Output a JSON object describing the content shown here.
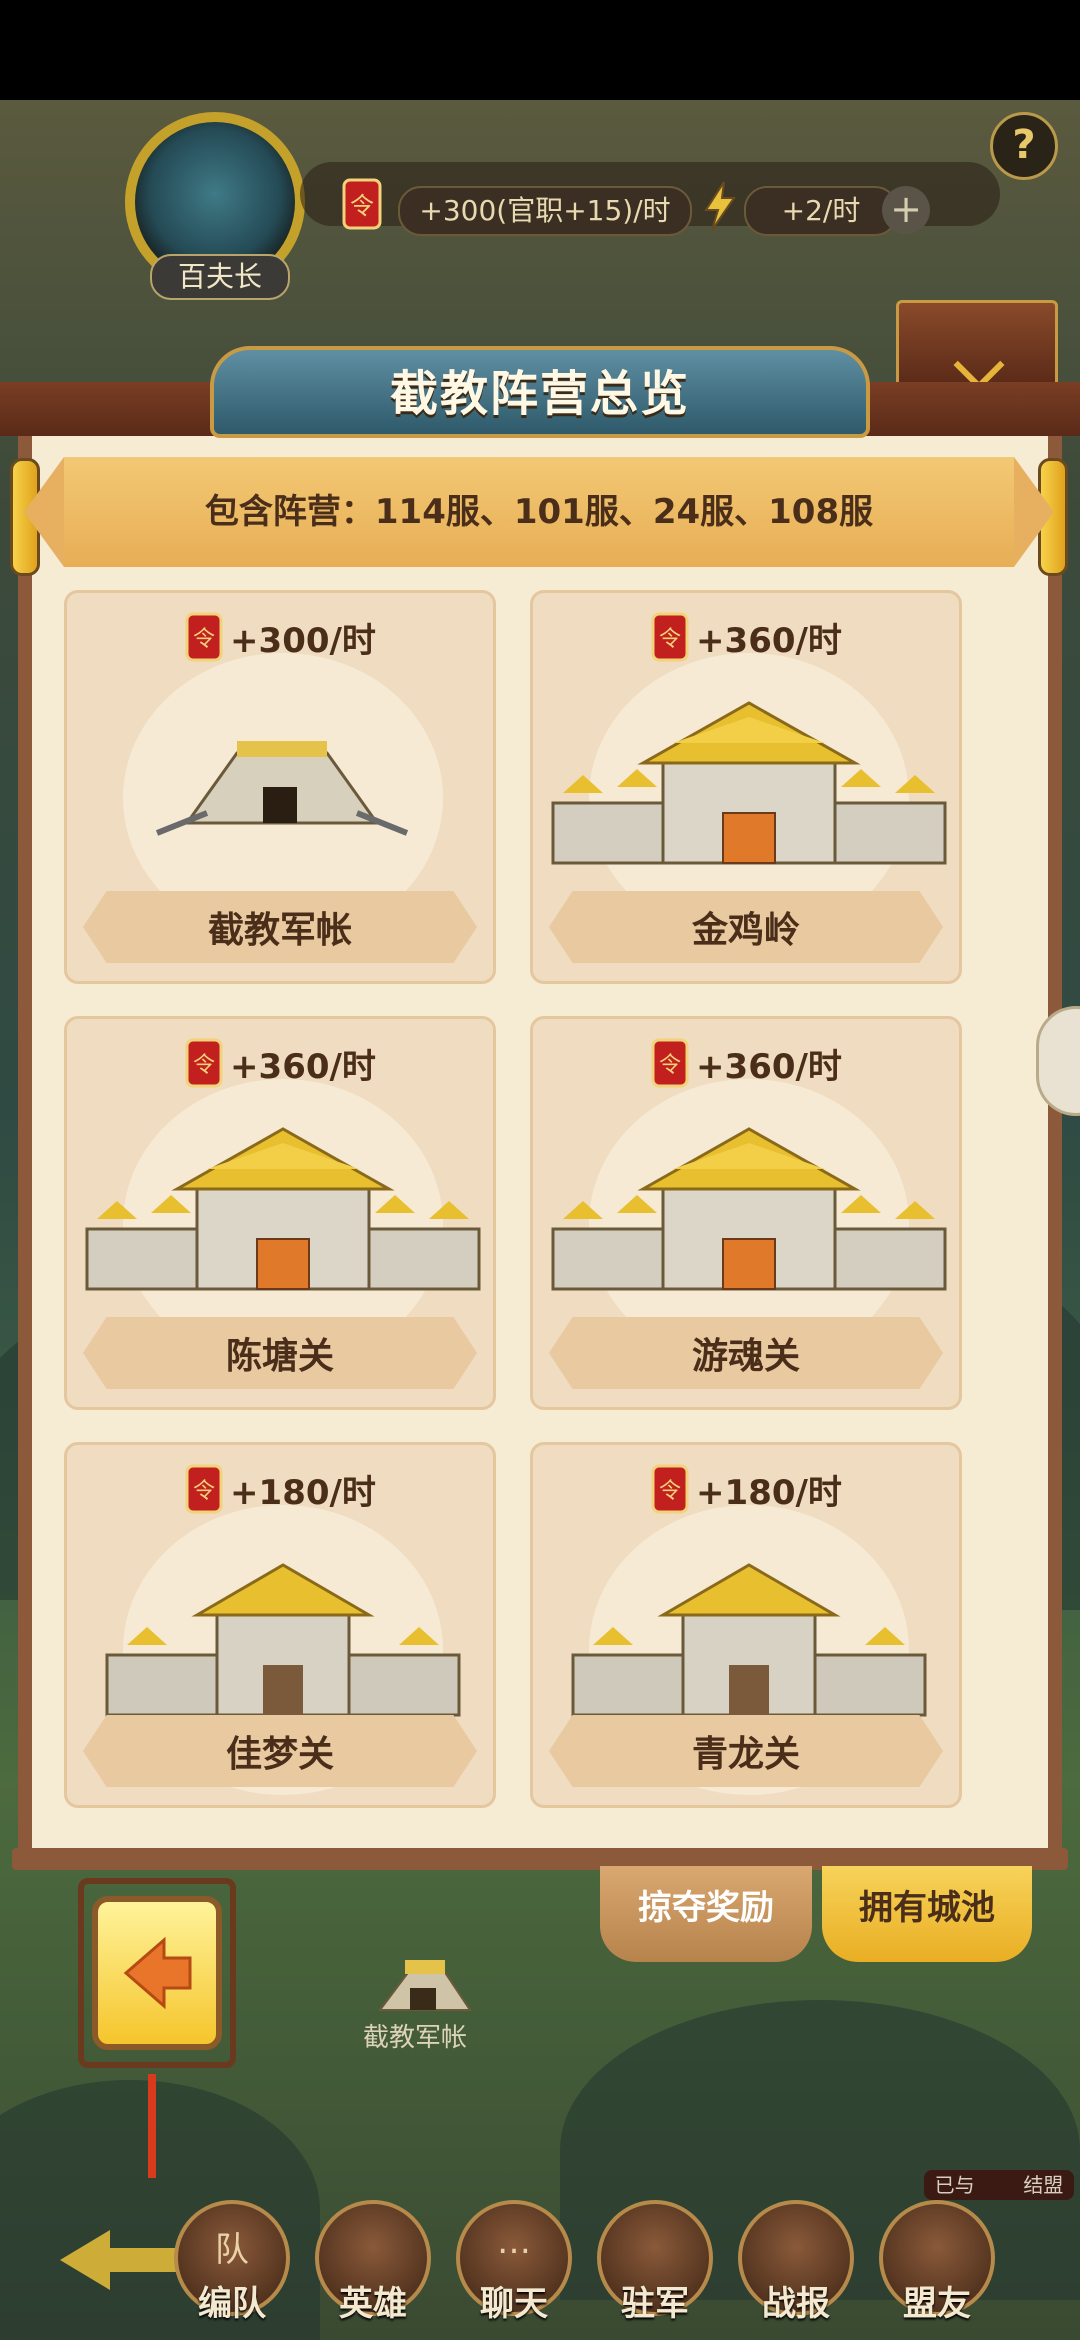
{
  "player": {
    "rank_badge": "百夫长"
  },
  "resources": {
    "supply_rate": "+300(官职+15)/时",
    "energy_rate": "+2/时"
  },
  "icons": {
    "help": "?",
    "add": "+"
  },
  "panel": {
    "title": "截教阵营总览",
    "included_servers": "包含阵营：114服、101服、24服、108服"
  },
  "cards": [
    {
      "rate": "+300/时",
      "name": "截教军帐",
      "type": "tent"
    },
    {
      "rate": "+360/时",
      "name": "金鸡岭",
      "type": "palace"
    },
    {
      "rate": "+360/时",
      "name": "陈塘关",
      "type": "palace"
    },
    {
      "rate": "+360/时",
      "name": "游魂关",
      "type": "palace"
    },
    {
      "rate": "+180/时",
      "name": "佳梦关",
      "type": "fort"
    },
    {
      "rate": "+180/时",
      "name": "青龙关",
      "type": "fort"
    }
  ],
  "tabs": {
    "plunder_rewards": "掠夺奖励",
    "owned_cities": "拥有城池"
  },
  "map": {
    "camp_label": "截教军帐"
  },
  "alliance_notice": "已与",
  "alliance_notice_tail": "结盟",
  "bottom_nav": [
    {
      "label": "编队",
      "icon": "team-icon",
      "glyph": "队"
    },
    {
      "label": "英雄",
      "icon": "hero-icon",
      "glyph": ""
    },
    {
      "label": "聊天",
      "icon": "chat-icon",
      "glyph": "…"
    },
    {
      "label": "驻军",
      "icon": "garrison-icon",
      "glyph": ""
    },
    {
      "label": "战报",
      "icon": "report-icon",
      "glyph": ""
    },
    {
      "label": "盟友",
      "icon": "ally-icon",
      "glyph": ""
    }
  ],
  "colors": {
    "gold": "#f5c52c",
    "panel": "#f6ebd3",
    "text_brown": "#4a2e1a",
    "roof": "#7a3e24"
  }
}
